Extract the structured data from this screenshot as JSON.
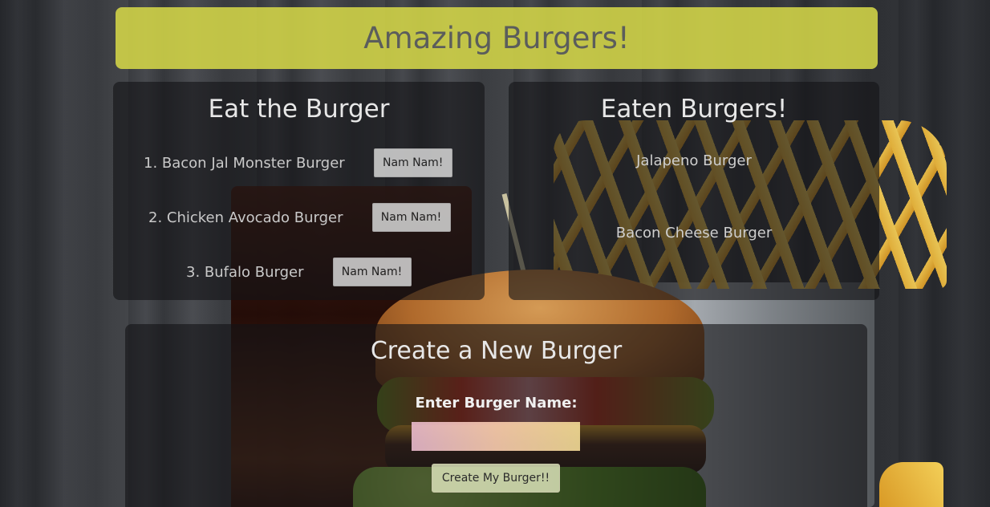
{
  "header": {
    "title": "Amazing Burgers!"
  },
  "eat_section": {
    "heading": "Eat the Burger",
    "burgers": [
      {
        "label": "1. Bacon Jal Monster Burger",
        "button": "Nam Nam!"
      },
      {
        "label": "2. Chicken Avocado Burger",
        "button": "Nam Nam!"
      },
      {
        "label": "3. Bufalo Burger",
        "button": "Nam Nam!"
      }
    ]
  },
  "eaten_section": {
    "heading": "Eaten Burgers!",
    "burgers": [
      "Jalapeno Burger",
      "Bacon Cheese Burger"
    ]
  },
  "create_section": {
    "heading": "Create a New Burger",
    "input_label": "Enter Burger Name:",
    "input_value": "",
    "submit_label": "Create My Burger!!"
  },
  "colors": {
    "banner": "#d4d648",
    "panel": "#141416"
  }
}
